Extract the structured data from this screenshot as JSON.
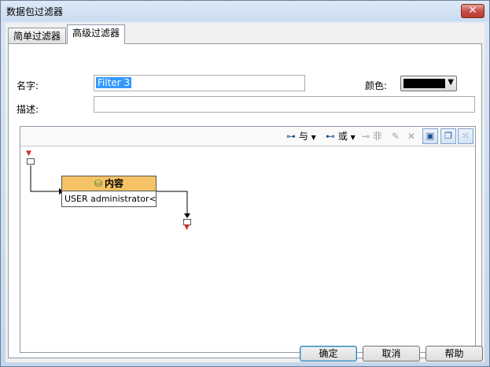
{
  "window": {
    "title": "数据包过滤器",
    "close_label": "✕"
  },
  "tabs": [
    {
      "label": "简单过滤器",
      "active": false
    },
    {
      "label": "高级过滤器",
      "active": true
    }
  ],
  "form": {
    "name_label": "名字:",
    "name_value": "Filter 3",
    "color_label": "颜色:",
    "color_value": "#000000",
    "desc_label": "描述:",
    "desc_value": ""
  },
  "toolbar": {
    "and_label": "与",
    "or_label": "或",
    "not_label": "非"
  },
  "diagram": {
    "node_title": "内容",
    "node_text": "USER administrator<C..."
  },
  "buttons": {
    "ok": "确定",
    "cancel": "取消",
    "help": "帮助"
  }
}
